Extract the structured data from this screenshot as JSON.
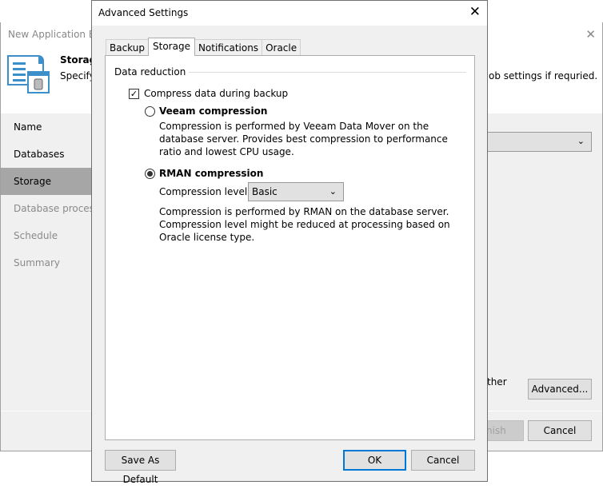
{
  "background_wizard": {
    "title": "New Application Ba",
    "step_title": "Storage",
    "step_description_left": "Specify",
    "step_description_right": "ob settings if requried.",
    "sidebar": {
      "items": [
        {
          "label": "Name",
          "state": "done"
        },
        {
          "label": "Databases",
          "state": "done"
        },
        {
          "label": "Storage",
          "state": "active"
        },
        {
          "label": "Database processing",
          "state": "disabled"
        },
        {
          "label": "Schedule",
          "state": "disabled"
        },
        {
          "label": "Summary",
          "state": "disabled"
        }
      ]
    },
    "partial_text_other": "ther",
    "advanced_button": "Advanced...",
    "finish_button": "nish",
    "cancel_button": "Cancel"
  },
  "dialog": {
    "title": "Advanced Settings",
    "tabs": [
      {
        "label": "Backup",
        "active": false
      },
      {
        "label": "Storage",
        "active": true
      },
      {
        "label": "Notifications",
        "active": false
      },
      {
        "label": "Oracle",
        "active": false
      }
    ],
    "group_label": "Data reduction",
    "compress_checkbox": {
      "label": "Compress data during backup",
      "checked": true,
      "glyph": "✓"
    },
    "veeam_option": {
      "label": "Veeam compression",
      "selected": false,
      "description": "Compression is performed by Veeam Data Mover on the database server. Provides best compression to performance ratio and lowest CPU usage."
    },
    "rman_option": {
      "label": "RMAN compression",
      "selected": true,
      "level_label": "Compression level:",
      "level_value": "Basic",
      "description": "Compression is performed by RMAN on the database server. Compression level might be reduced at processing based on Oracle license type."
    },
    "buttons": {
      "save_default": "Save As Default",
      "ok": "OK",
      "cancel": "Cancel"
    }
  },
  "icons": {
    "close": "✕",
    "chevron_down": "⌄"
  },
  "colors": {
    "accent_focus": "#0078d7",
    "sidebar_active": "#a6a6a6",
    "icon_blue": "#3c8fc8"
  }
}
